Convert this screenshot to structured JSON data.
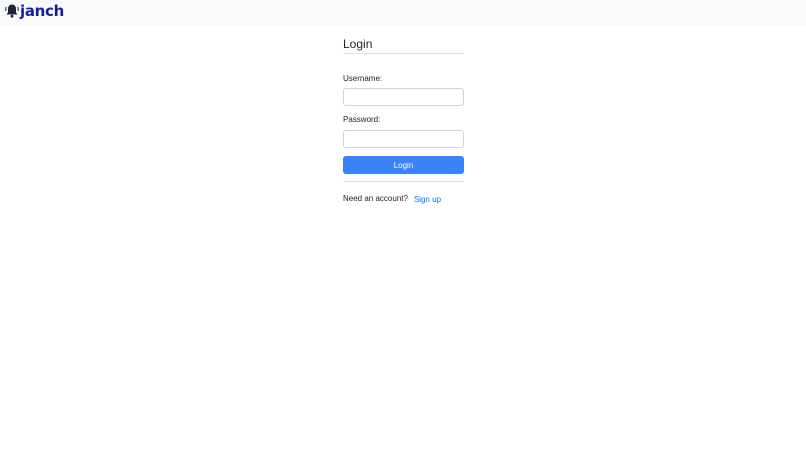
{
  "navbar": {
    "brand_name": "janch",
    "brand_icon": "bell-icon",
    "brand_color": "#1b1f8f",
    "background": "#f8f9fa"
  },
  "login": {
    "title": "Login",
    "username_label": "Username:",
    "username_value": "",
    "password_label": "Password:",
    "password_value": "",
    "submit_label": "Login",
    "submit_color": "#3b82f6",
    "account_prompt": "Need an account?",
    "signup_link": "Sign up"
  }
}
